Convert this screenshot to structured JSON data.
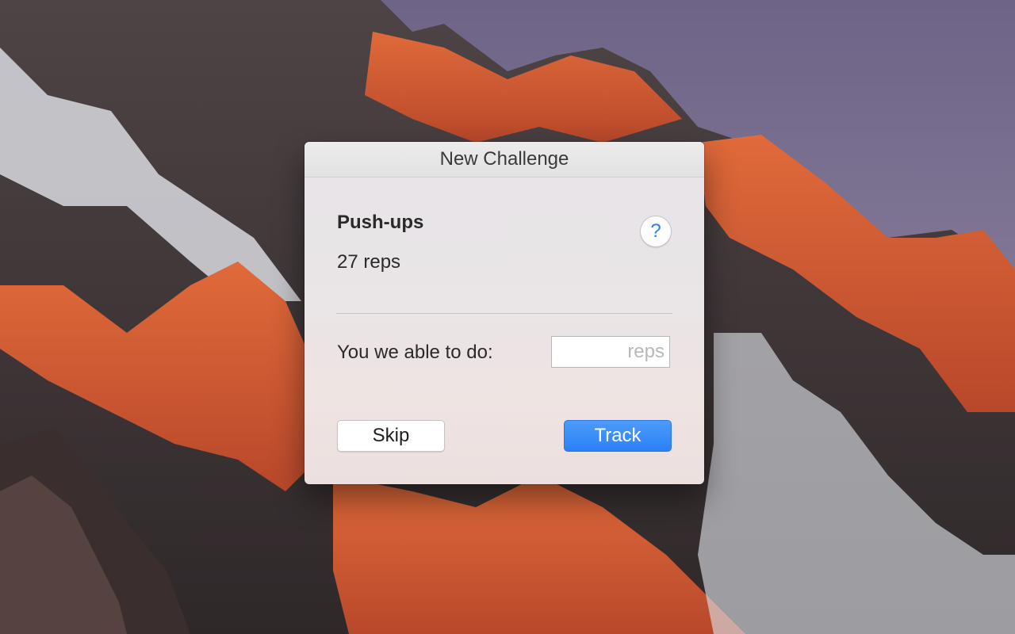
{
  "dialog": {
    "title": "New Challenge",
    "exercise_name": "Push-ups",
    "exercise_target": "27 reps",
    "help_icon": "question-mark-icon",
    "help_glyph": "?",
    "field_label": "You we able to do:",
    "input_value": "",
    "input_placeholder": "reps",
    "skip_label": "Skip",
    "track_label": "Track"
  },
  "colors": {
    "accent": "#2a80f6",
    "help_icon": "#2b7fe8"
  }
}
